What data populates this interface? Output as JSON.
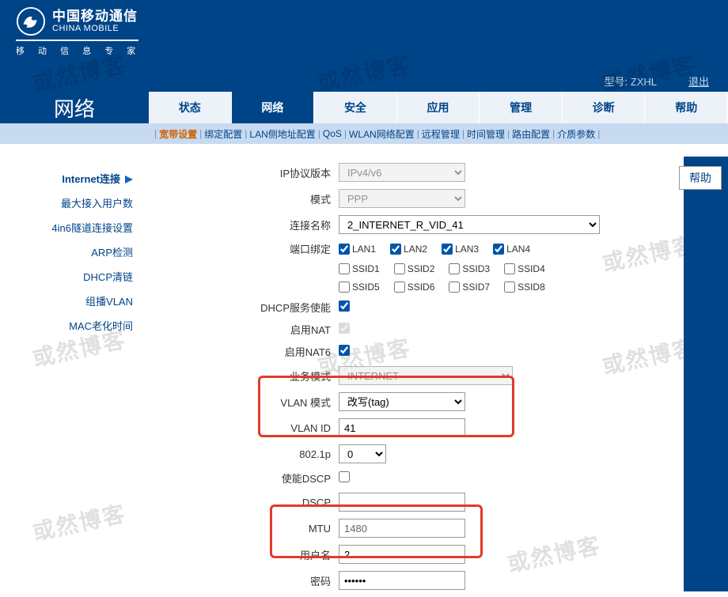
{
  "brand": {
    "cn": "中国移动通信",
    "en": "CHINA MOBILE",
    "slogan": "移 动 信 息 专 家"
  },
  "topbar": {
    "model_label": "型号:",
    "model_value": "ZXHL",
    "logout": "退出"
  },
  "nav_title": "网络",
  "tabs": {
    "status": "状态",
    "network": "网络",
    "security": "安全",
    "app": "应用",
    "manage": "管理",
    "diag": "诊断",
    "help": "帮助"
  },
  "subnav": {
    "broadband": "宽带设置",
    "bind": "绑定配置",
    "lan": "LAN侧地址配置",
    "qos": "QoS",
    "wlan": "WLAN网络配置",
    "remote": "远程管理",
    "time": "时间管理",
    "route": "路由配置",
    "media": "介质参数"
  },
  "sidebar": {
    "internet": "Internet连接",
    "maxuser": "最大接入用户数",
    "tunnel": "4in6隧道连接设置",
    "arp": "ARP检测",
    "dhcp": "DHCP清链",
    "mvlan": "组播VLAN",
    "macage": "MAC老化时间"
  },
  "form": {
    "ipver_label": "IP协议版本",
    "ipver_value": "IPv4/v6",
    "mode_label": "模式",
    "mode_value": "PPP",
    "conn_label": "连接名称",
    "conn_value": "2_INTERNET_R_VID_41",
    "portbind_label": "端口绑定",
    "lan1": "LAN1",
    "lan2": "LAN2",
    "lan3": "LAN3",
    "lan4": "LAN4",
    "ssid1": "SSID1",
    "ssid2": "SSID2",
    "ssid3": "SSID3",
    "ssid4": "SSID4",
    "ssid5": "SSID5",
    "ssid6": "SSID6",
    "ssid7": "SSID7",
    "ssid8": "SSID8",
    "dhcp_en_label": "DHCP服务使能",
    "nat_label": "启用NAT",
    "nat6_label": "启用NAT6",
    "biz_label": "业务模式",
    "biz_value": "INTERNET",
    "vlanmode_label": "VLAN 模式",
    "vlanmode_value": "改写(tag)",
    "vlanid_label": "VLAN ID",
    "vlanid_value": "41",
    "dot1p_label": "802.1p",
    "dot1p_value": "0",
    "dscp_en_label": "使能DSCP",
    "dscp_label": "DSCP",
    "dscp_value": "",
    "mtu_label": "MTU",
    "mtu_value": "1480",
    "user_label": "用户名",
    "user_value": "2",
    "pass_label": "密码",
    "pass_value": "••••••"
  },
  "help_btn": "帮助",
  "watermark": "或然博客"
}
